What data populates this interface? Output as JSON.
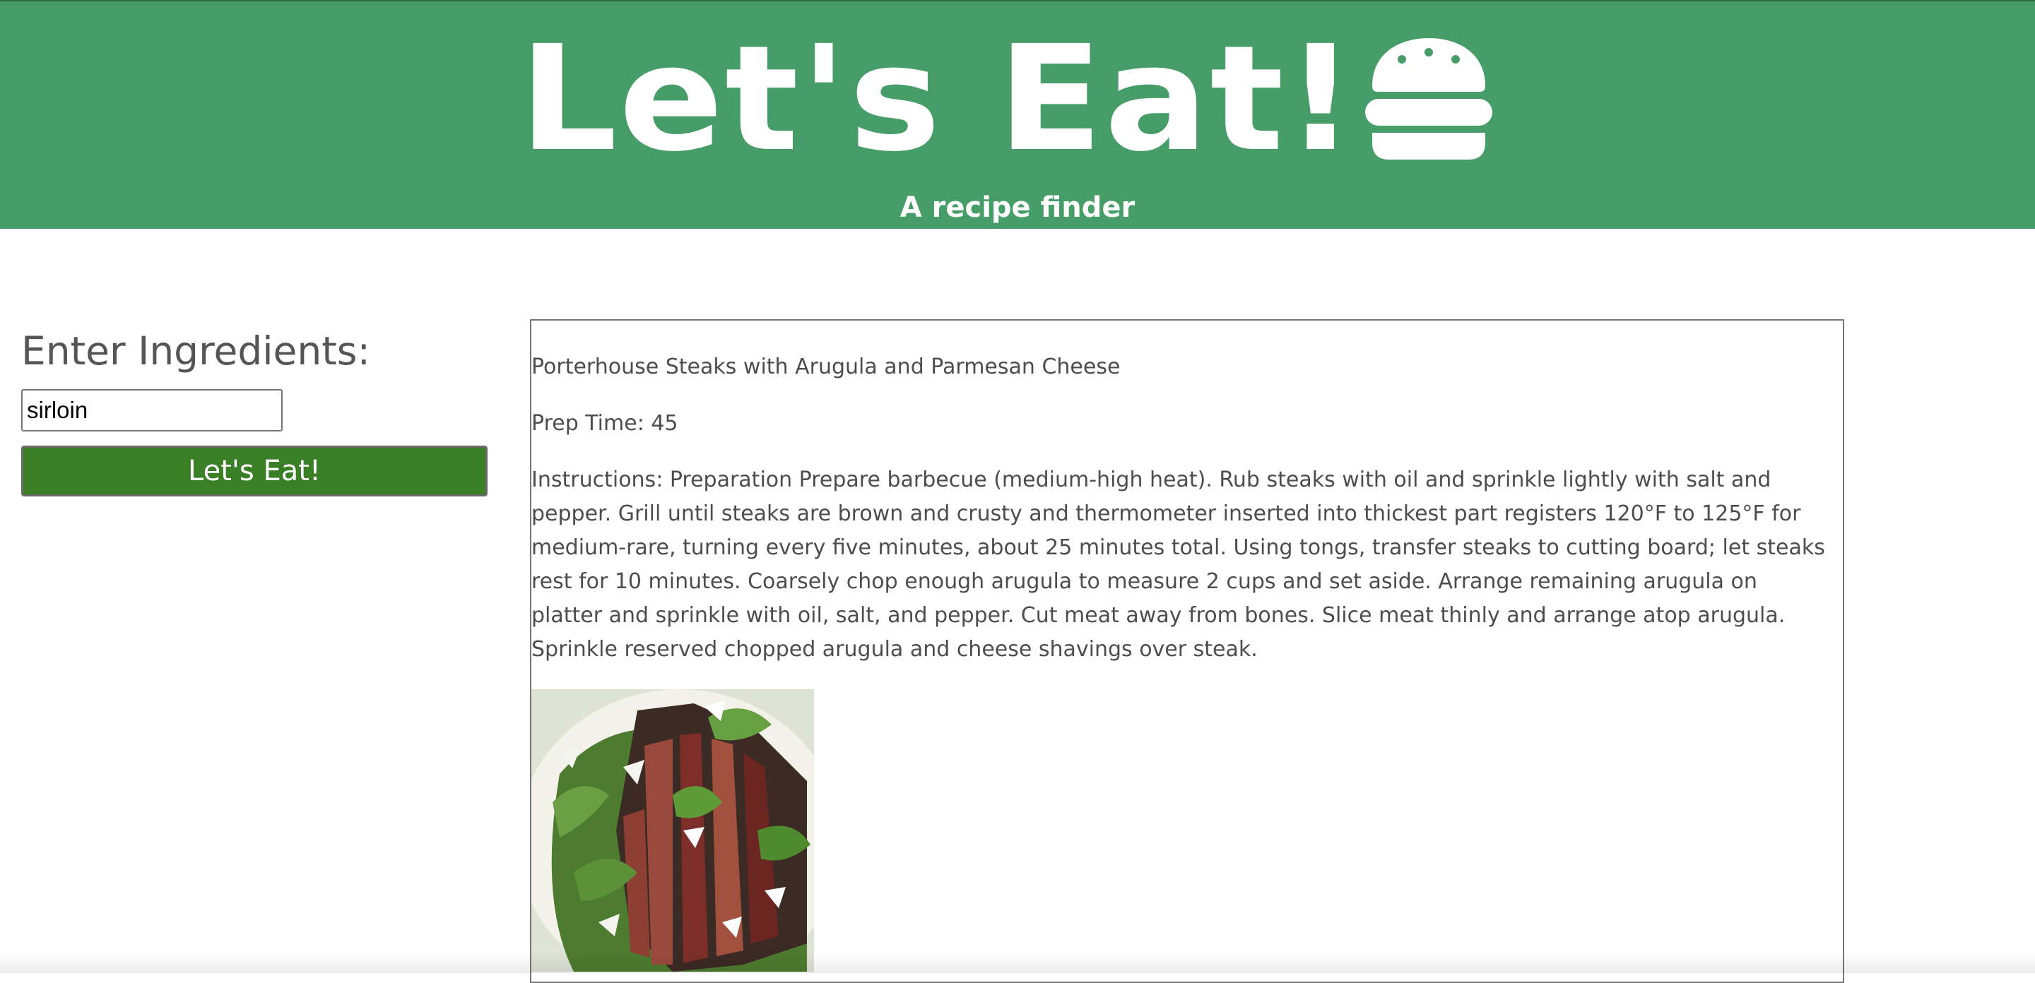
{
  "header": {
    "title": "Let's Eat!",
    "subtitle": "A recipe finder",
    "icon": "burger-icon",
    "background_color": "#479d67"
  },
  "search": {
    "heading": "Enter Ingredients:",
    "input_value": "sirloin",
    "button_label": "Let's Eat!",
    "button_color": "#3a7f26"
  },
  "recipe": {
    "title": "Porterhouse Steaks with Arugula and Parmesan Cheese",
    "prep_time": "Prep Time: 45",
    "instructions": "Instructions: Preparation Prepare barbecue (medium-high heat). Rub steaks with oil and sprinkle lightly with salt and pepper. Grill until steaks are brown and crusty and thermometer inserted into thickest part registers 120°F to 125°F for medium-rare, turning every five minutes, about 25 minutes total. Using tongs, transfer steaks to cutting board; let steaks rest for 10 minutes. Coarsely chop enough arugula to measure 2 cups and set aside. Arrange remaining arugula on platter and sprinkle with oil, salt, and pepper. Cut meat away from bones. Slice meat thinly and arrange atop arugula. Sprinkle reserved chopped arugula and cheese shavings over steak.",
    "image_subject": "sliced steak on arugula with parmesan shavings"
  }
}
